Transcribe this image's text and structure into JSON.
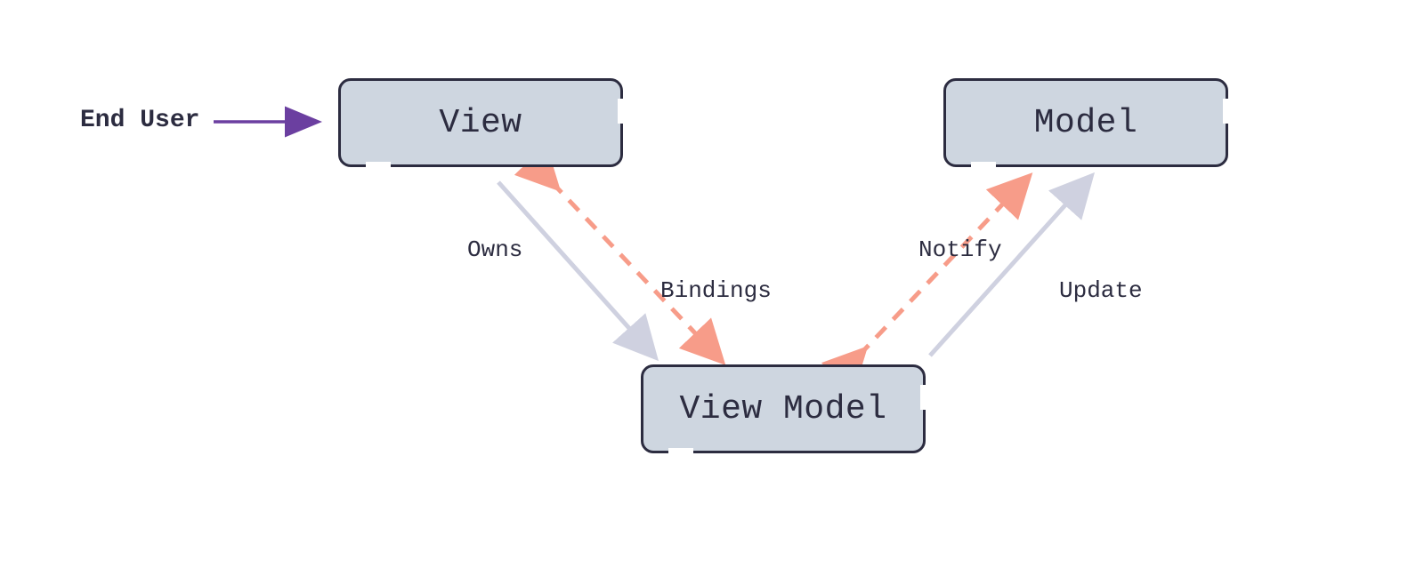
{
  "colors": {
    "node_fill": "#ced6e0",
    "node_border": "#2c2c40",
    "text": "#2c2c40",
    "arrow_gray": "#cfd1e0",
    "arrow_coral": "#f79c89",
    "arrow_purple": "#6b3fa0"
  },
  "nodes": {
    "view": {
      "label": "View"
    },
    "model": {
      "label": "Model"
    },
    "view_model": {
      "label": "View Model"
    }
  },
  "external": {
    "end_user": "End User"
  },
  "edges": {
    "owns": "Owns",
    "bindings": "Bindings",
    "notify": "Notify",
    "update": "Update"
  }
}
